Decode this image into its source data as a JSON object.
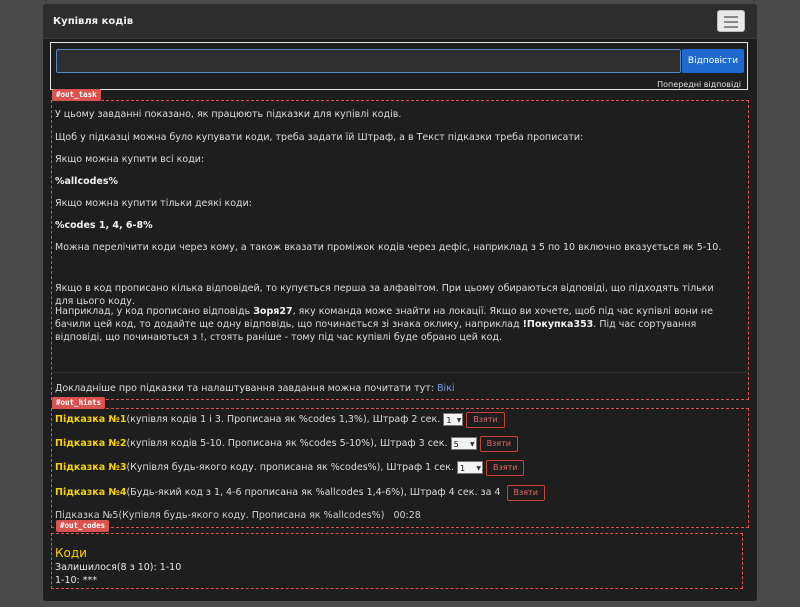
{
  "header": {
    "title": "Купівля кодів",
    "menu_icon": "hamburger-icon"
  },
  "answer": {
    "value": "",
    "placeholder": "",
    "submit_label": "Відповісти",
    "previous_label": "Попередні відповіді"
  },
  "sections": {
    "task_tag": "#out_task",
    "hints_tag": "#out_hints",
    "codes_tag": "#out_codes"
  },
  "task": {
    "p1": "У цьому завданні показано, як працюють підказки для купівлі кодів.",
    "p2": "Щоб у підказці можна було купувати коди, треба задати їй Штраф, а в Текст підказки треба прописати:",
    "p3": "Якщо можна купити всі коди:",
    "p4": "%allcodes%",
    "p5": "Якщо можна купити тільки деякі коди:",
    "p6": "%codes 1, 4, 6-8%",
    "p7": "Можна перелічити коди через кому, а також вказати проміжок кодів через дефіс, наприклад з 5 по 10 включно вказується як 5-10.",
    "p8": "Якщо в код прописано кілька відповідей, то купується перша за алфавітом. При цьому обираються відповіді, що підходять тільки для цього коду.",
    "p9_a": "Наприклад, у код прописано відповідь ",
    "p9_b": "Зоря27",
    "p9_c": ", яку команда може знайти на локації. Якщо ви хочете, щоб під час купівлі вони не бачили цей код, то додайте ще одну відповідь, що починається зі знака оклику, наприклад ",
    "p9_d": "!Покупка353",
    "p9_e": ". Під час сортування відповіді, що починаються з !, стоять раніше - тому під час купівлі буде обрано цей код.",
    "p10": "Докладніше про підказки та налаштування завдання можна почитати тут: ",
    "wiki": "Вікі"
  },
  "hints": [
    {
      "title": "Підказка №1",
      "text": "(купівля кодів 1 і 3. Прописана як %codes 1,3%), Штраф 2 сек.",
      "select": "1",
      "button": "Взяти"
    },
    {
      "title": "Підказка №2",
      "text": "(купівля кодів 5-10. Прописана як %codes 5-10%), Штраф 3 сек.",
      "select": "5",
      "button": "Взяти"
    },
    {
      "title": "Підказка №3",
      "text": "(Купівля будь-якого коду. прописана як %codes%), Штраф 1 сек.",
      "select": "1",
      "button": "Взяти"
    },
    {
      "title": "Підказка №4",
      "text": "(Будь-який код з 1, 4-6 прописана як %allcodes 1,4-6%), Штраф 4 сек. за 4",
      "button": "Взяти"
    }
  ],
  "hint5": {
    "text": "Підказка №5(Купівля будь-якого коду. Прописана як %allcodes%)",
    "timer": "00:28"
  },
  "codes": {
    "title": "Коди",
    "remaining": "Залишилося(8 з 10): 1-10",
    "list": "1-10: ***"
  }
}
